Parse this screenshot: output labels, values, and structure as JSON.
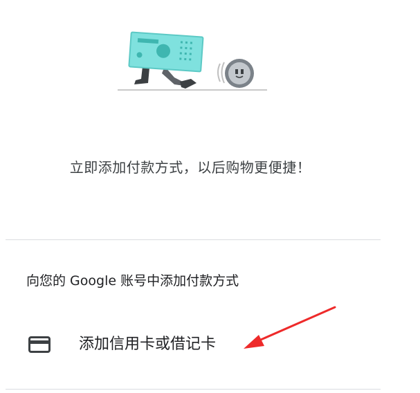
{
  "promo": {
    "message": "立即添加付款方式，以后购物更便捷！"
  },
  "section": {
    "heading": "向您的 Google 账号中添加付款方式"
  },
  "payment_options": [
    {
      "label": "添加信用卡或借记卡",
      "icon": "credit-card-icon"
    }
  ],
  "colors": {
    "banknote": "#7fe1de",
    "banknote_dark": "#3fb6b0",
    "coin": "#8a9198",
    "arrow": "#ee2a2a",
    "divider": "#dadce0",
    "text": "#202124"
  }
}
